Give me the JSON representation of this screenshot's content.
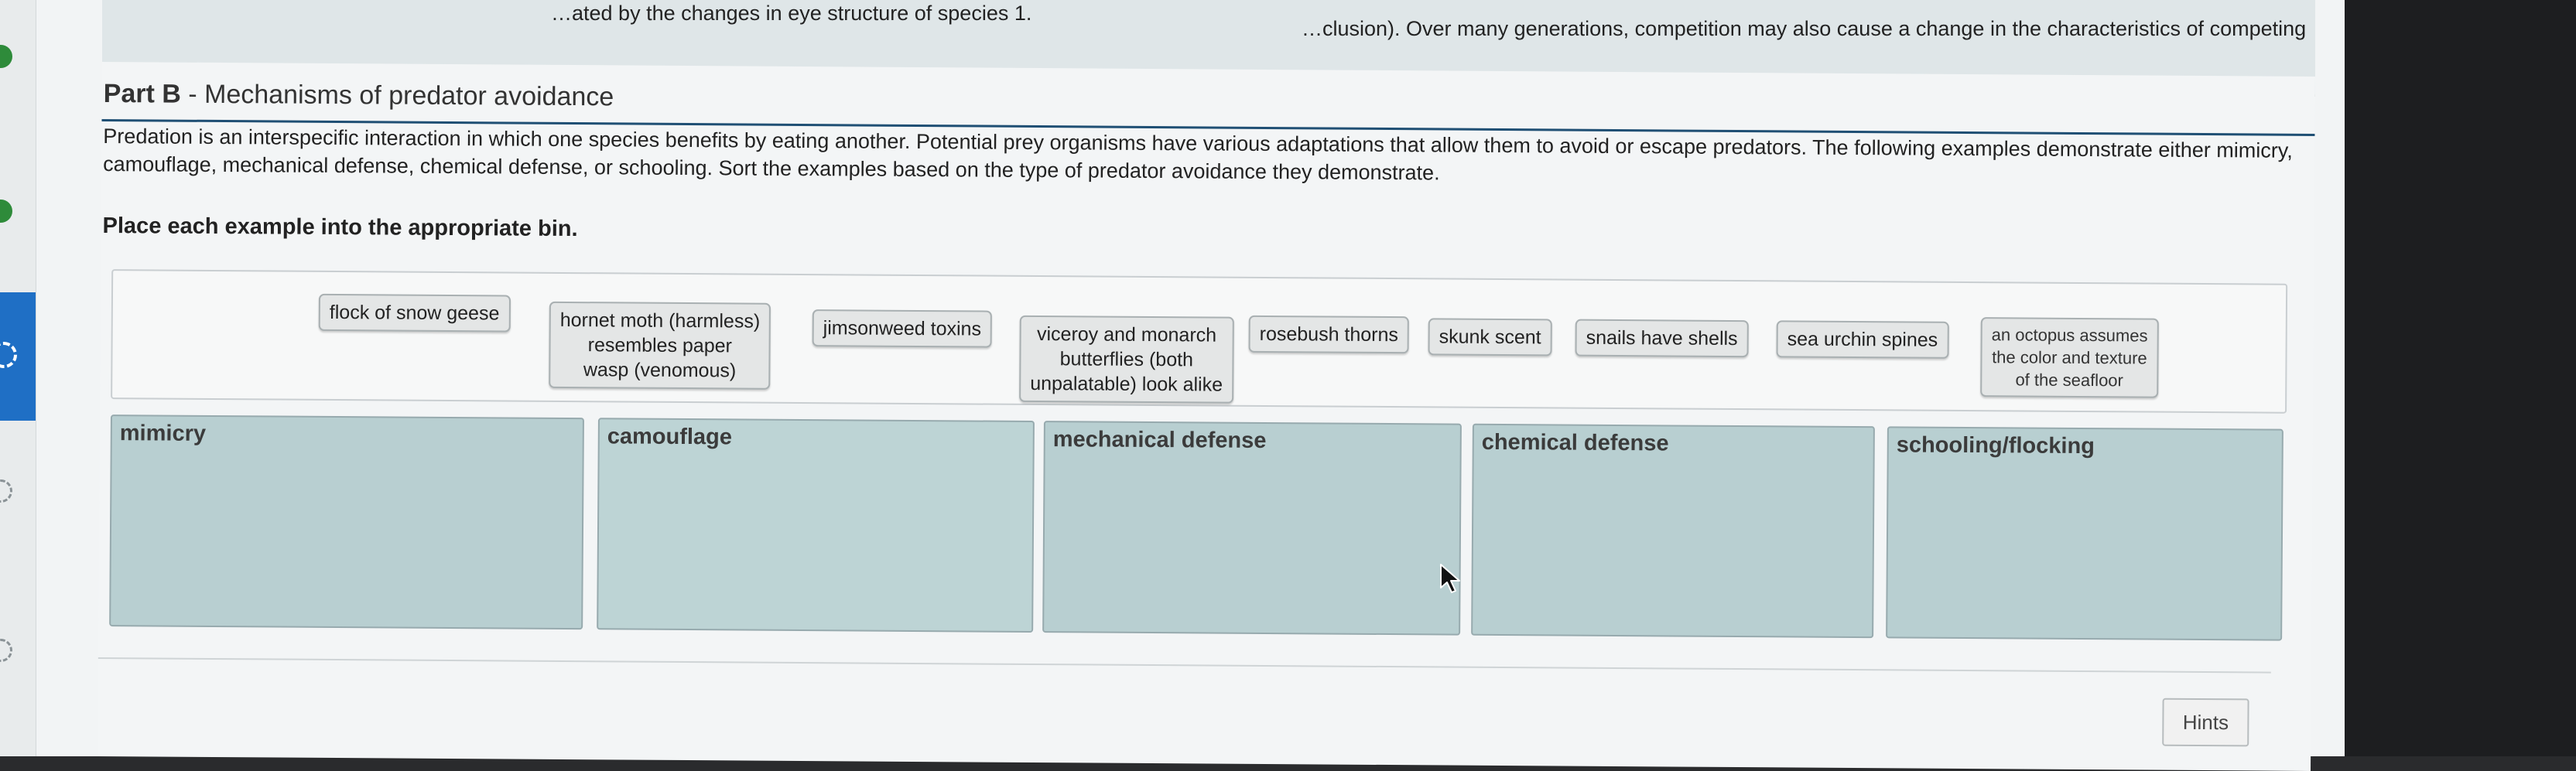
{
  "previous_part": {
    "text_left": "…ated by the changes in eye structure of species 1.",
    "text_right": "…clusion). Over many generations, competition may also cause a change in the characteristics of competing"
  },
  "part_b": {
    "prefix": "Part B",
    "title": " - Mechanisms of predator avoidance"
  },
  "intro_text": "Predation is an interspecific interaction in which one species benefits by eating another. Potential prey organisms have various adaptations that allow them to avoid or escape predators. The following examples demonstrate either mimicry, camouflage, mechanical defense, chemical defense, or schooling. Sort the examples based on the type of predator avoidance they demonstrate.",
  "instruction": "Place each example into the appropriate bin.",
  "chips": [
    {
      "line1": "flock of snow geese",
      "line2": "",
      "line3": ""
    },
    {
      "line1": "hornet moth (harmless)",
      "line2": "resembles paper",
      "line3": "wasp (venomous)"
    },
    {
      "line1": "jimsonweed toxins",
      "line2": "",
      "line3": ""
    },
    {
      "line1": "viceroy and monarch",
      "line2": "butterflies (both",
      "line3": "unpalatable) look alike"
    },
    {
      "line1": "rosebush thorns",
      "line2": "",
      "line3": ""
    },
    {
      "line1": "skunk scent",
      "line2": "",
      "line3": ""
    },
    {
      "line1": "snails have shells",
      "line2": "",
      "line3": ""
    },
    {
      "line1": "sea urchin spines",
      "line2": "",
      "line3": ""
    },
    {
      "line1": "an octopus assumes",
      "line2": "the color and texture",
      "line3": "of the seafloor"
    }
  ],
  "bins": [
    {
      "label": "mimicry"
    },
    {
      "label": "camouflage"
    },
    {
      "label": "mechanical defense"
    },
    {
      "label": "chemical defense"
    },
    {
      "label": "schooling/flocking"
    }
  ],
  "hints_label": "Hints",
  "colors": {
    "bin_fill": "#b8cfd1",
    "title_rule": "#1f4f74",
    "chip_fill": "#e4e6e6",
    "progress_active": "#1f6fc5",
    "progress_done": "#2e8b3a"
  }
}
